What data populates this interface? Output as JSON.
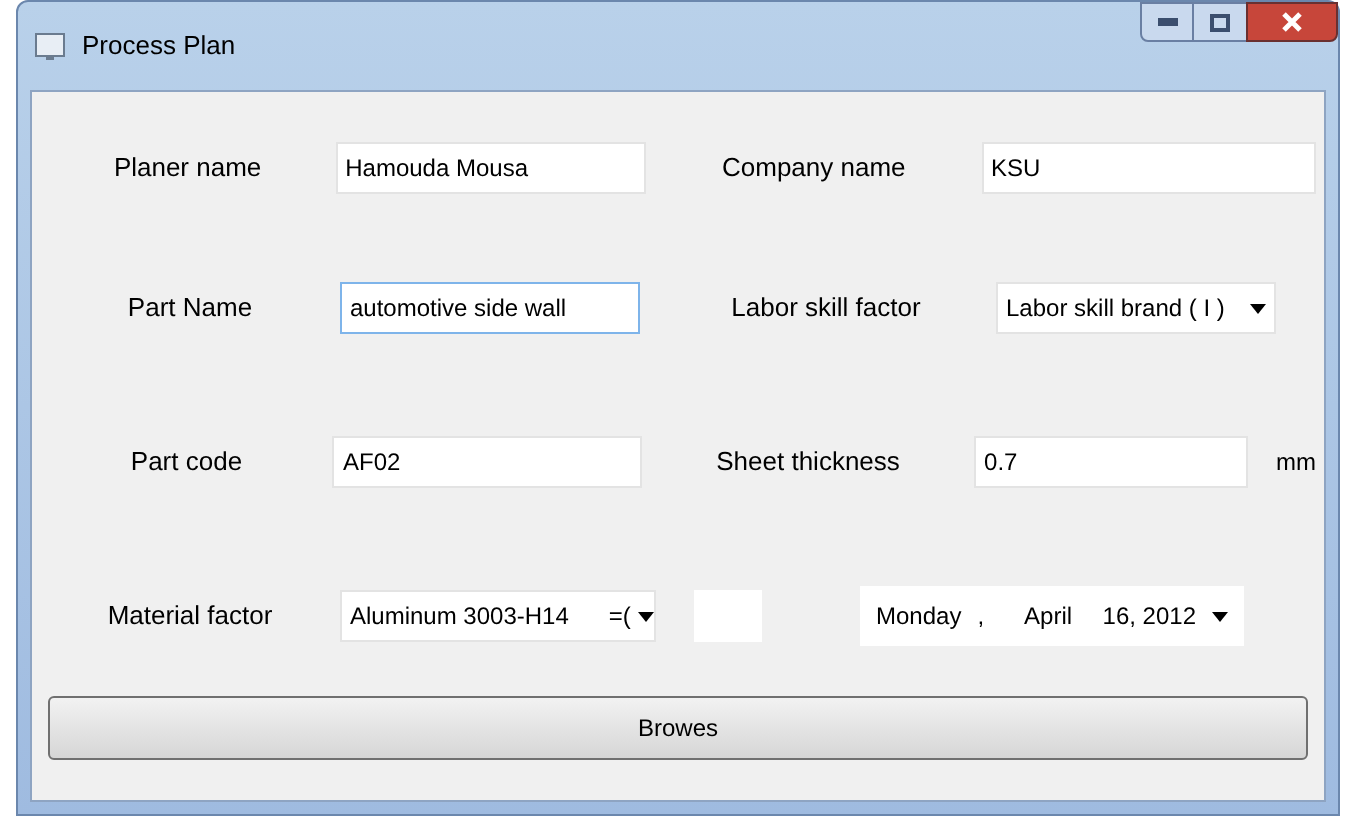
{
  "window": {
    "title": "Process Plan"
  },
  "fields": [
    {
      "label": "Planer name",
      "value": "Hamouda Mousa"
    },
    {
      "label": "Company name",
      "value": "KSU"
    },
    {
      "label": "Part Name",
      "value": "automotive side wall",
      "focused": true
    },
    {
      "label": "Labor skill factor",
      "value": "Labor skill brand ( I )",
      "kind": "dropdown"
    },
    {
      "label": "Part code",
      "value": "AF02"
    },
    {
      "label": "Sheet thickness",
      "value": "0.7",
      "unit": "mm"
    },
    {
      "label": "Material factor",
      "value": "Aluminum 3003-H14      =(",
      "kind": "dropdown"
    }
  ],
  "date_picker": {
    "day": "Monday",
    "separator": ",",
    "month": "April",
    "date": "16, 2012"
  },
  "button": "Browes"
}
